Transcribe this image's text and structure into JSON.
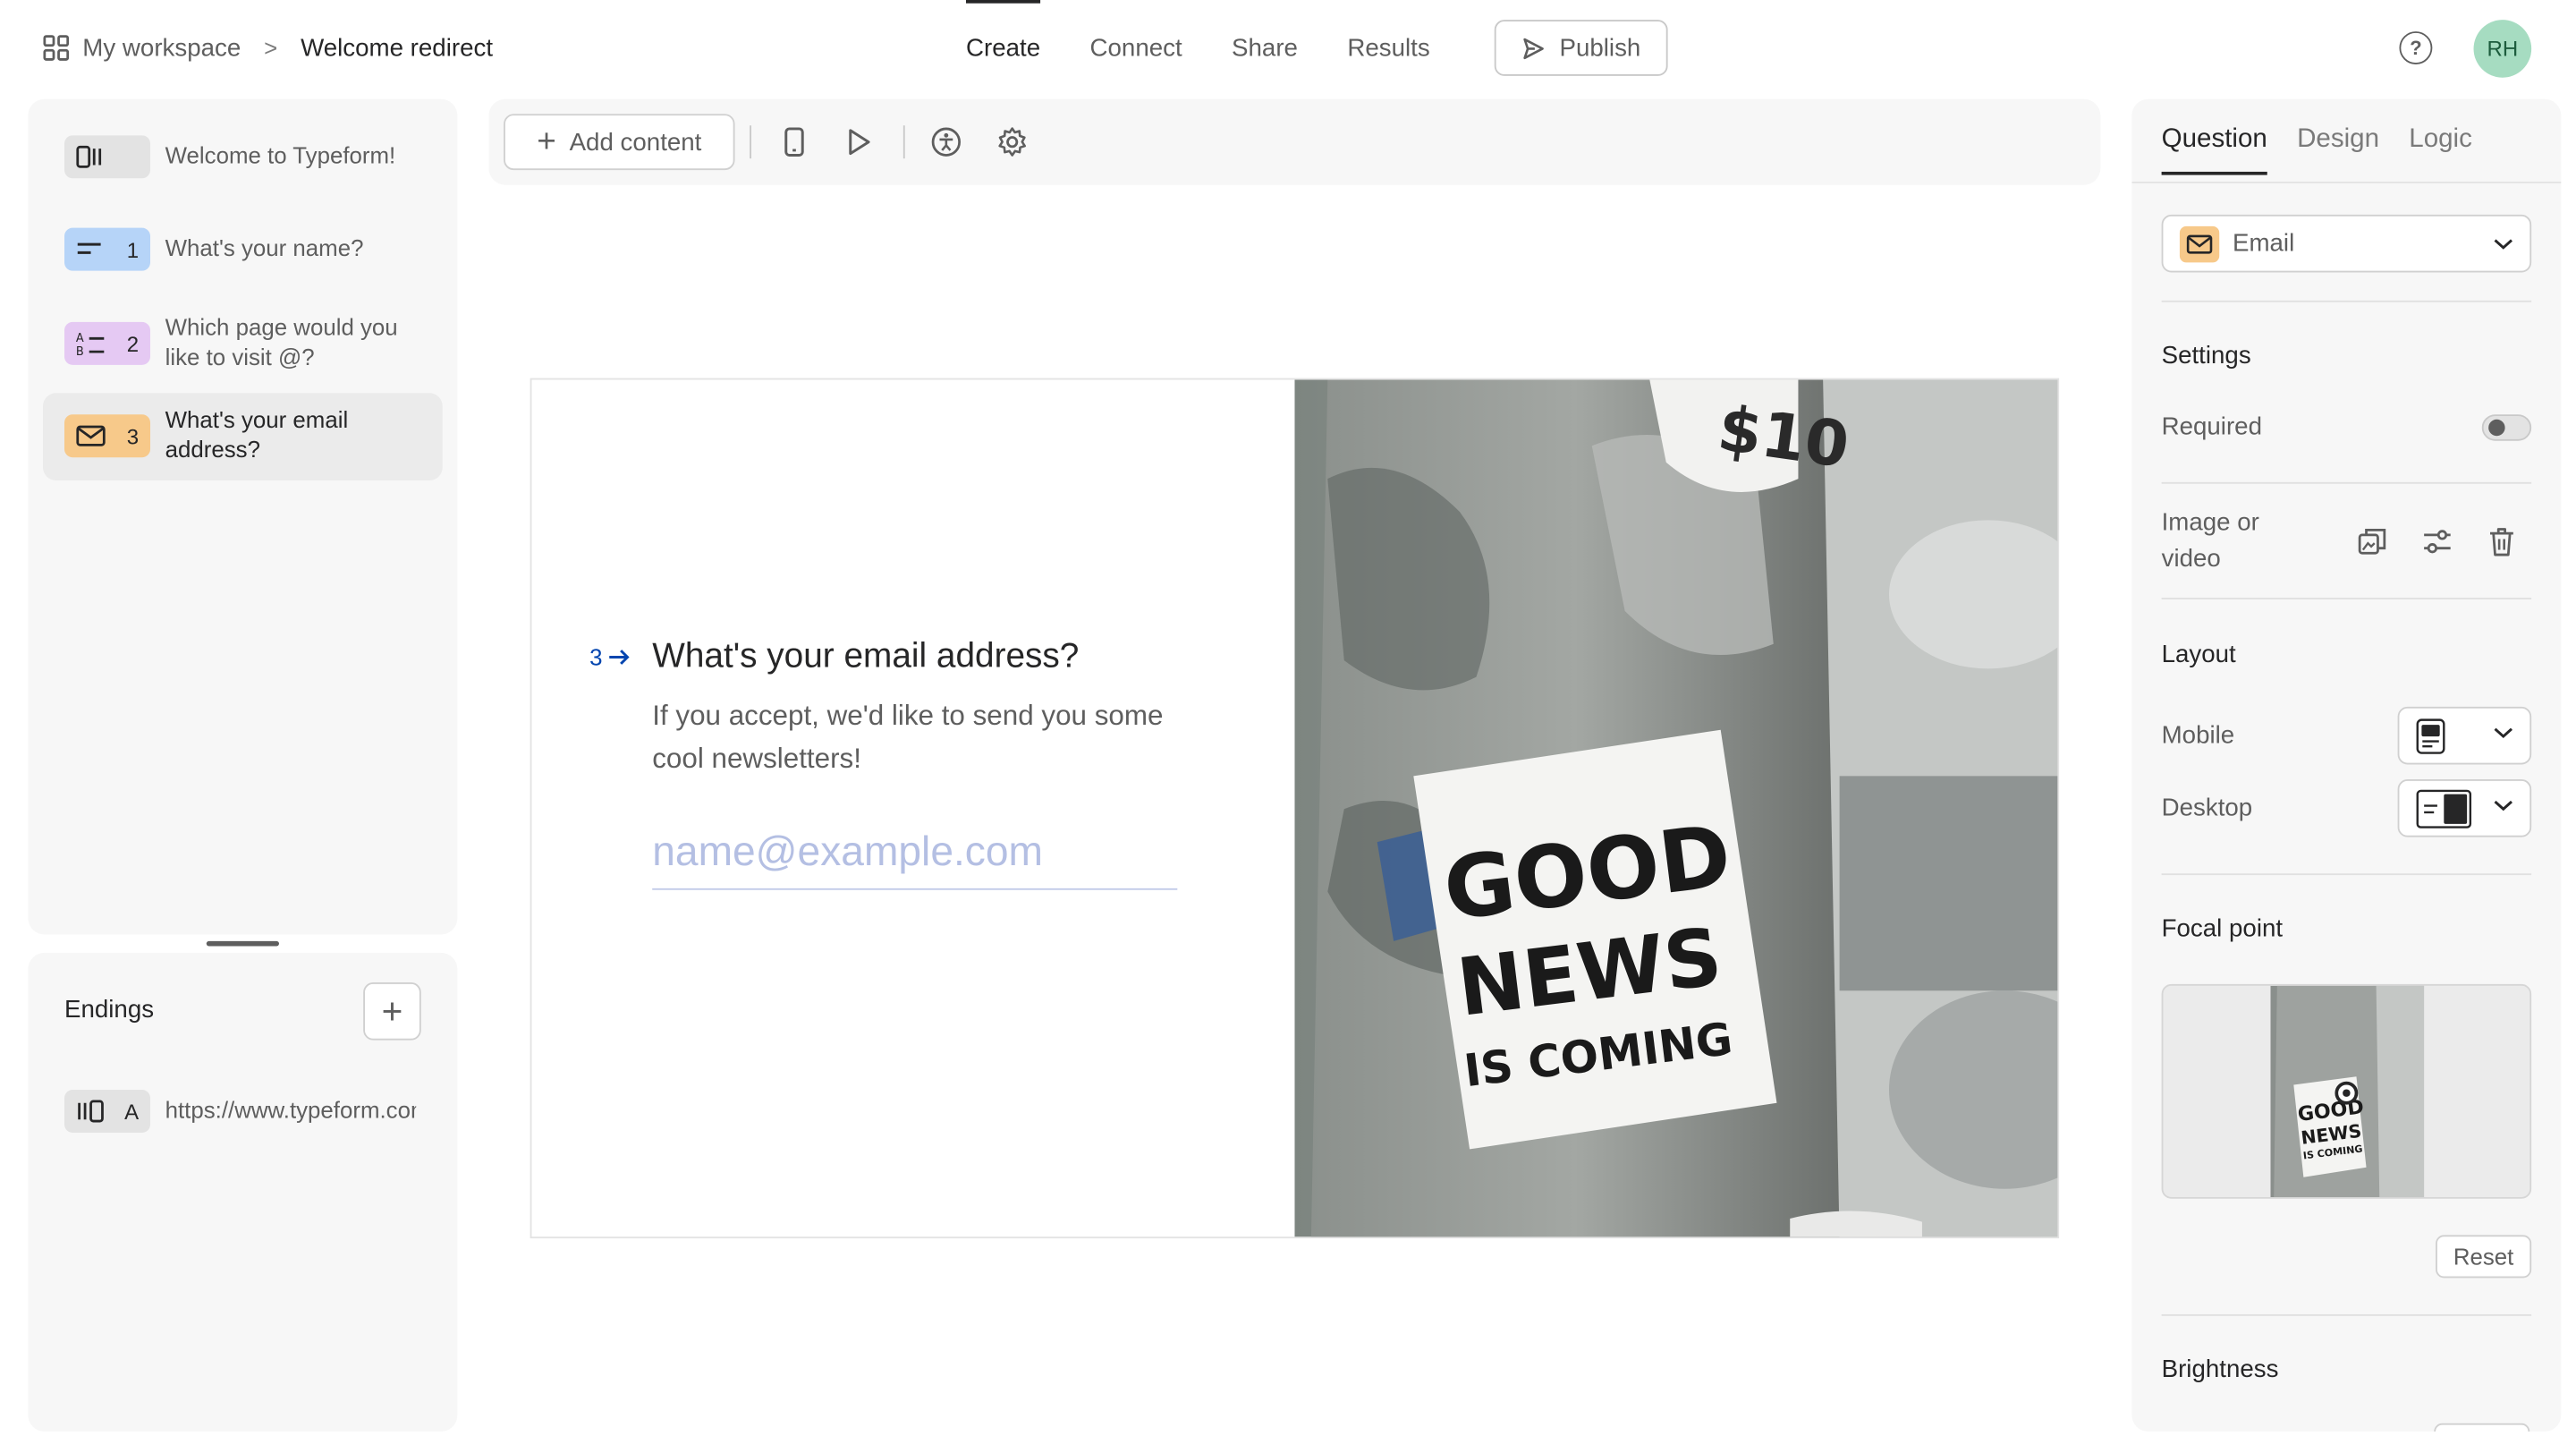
{
  "breadcrumb": {
    "workspace": "My workspace",
    "separator": ">",
    "form_name": "Welcome redirect"
  },
  "nav_tabs": [
    {
      "label": "Create",
      "active": true
    },
    {
      "label": "Connect",
      "active": false
    },
    {
      "label": "Share",
      "active": false
    },
    {
      "label": "Results",
      "active": false
    }
  ],
  "publish_label": "Publish",
  "help_glyph": "?",
  "user_initials": "RH",
  "questions": [
    {
      "num": "",
      "text": "Welcome to Typeform!",
      "icon": "welcome-screen-icon",
      "color": "#e3e3e3"
    },
    {
      "num": "1",
      "text": "What's your name?",
      "icon": "short-text-icon",
      "color": "#b6d4f8"
    },
    {
      "num": "2",
      "text": "Which page would you like to visit @?",
      "icon": "multiple-choice-icon",
      "color": "#e5c9f3"
    },
    {
      "num": "3",
      "text": "What's your email address?",
      "icon": "email-icon",
      "color": "#f7c98a",
      "active": true
    }
  ],
  "endings": {
    "title": "Endings",
    "add_glyph": "+",
    "items": [
      {
        "letter": "A",
        "url": "https://www.typeform.com",
        "icon": "redirect-icon"
      }
    ]
  },
  "toolbar": {
    "add_content_label": "Add content",
    "add_glyph": "+"
  },
  "preview": {
    "question_number": "3",
    "question_title": "What's your email address?",
    "question_description": "If you accept, we'd like to send you some cool newsletters!",
    "placeholder": "name@example.com",
    "image_text": [
      "GOOD",
      "NEWS",
      "IS COMING"
    ],
    "image_partial_text": "$10"
  },
  "right_panel": {
    "tabs": [
      {
        "label": "Question",
        "active": true
      },
      {
        "label": "Design",
        "active": false
      },
      {
        "label": "Logic",
        "active": false
      }
    ],
    "question_type": "Email",
    "settings_title": "Settings",
    "required_label": "Required",
    "required_on": false,
    "media_label": "Image or video",
    "layout_title": "Layout",
    "mobile_label": "Mobile",
    "desktop_label": "Desktop",
    "focal_title": "Focal point",
    "reset_label": "Reset",
    "brightness_title": "Brightness"
  },
  "colors": {
    "accent_blue": "#0445af",
    "avatar_bg": "#a6dcc1",
    "email_badge": "#f7c98a"
  }
}
